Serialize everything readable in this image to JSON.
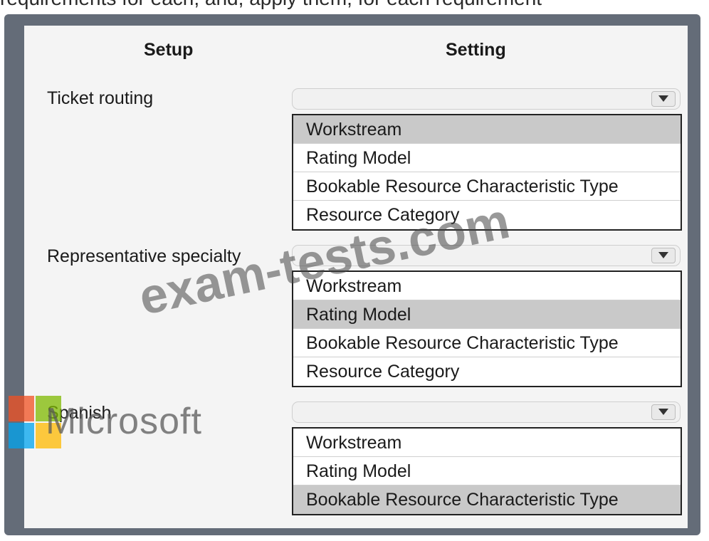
{
  "top_text": "requirements for each, and, apply them, for each requirement",
  "headers": {
    "setup": "Setup",
    "setting": "Setting"
  },
  "rows": [
    {
      "label": "Ticket routing",
      "selected_value": "",
      "options": [
        "Workstream",
        "Rating Model",
        "Bookable Resource Characteristic Type",
        "Resource Category"
      ],
      "highlighted": "Workstream"
    },
    {
      "label": "Representative specialty",
      "selected_value": "",
      "options": [
        "Workstream",
        "Rating Model",
        "Bookable Resource Characteristic Type",
        "Resource Category"
      ],
      "highlighted": "Rating Model"
    },
    {
      "label": "Spanish",
      "selected_value": "",
      "options": [
        "Workstream",
        "Rating Model",
        "Bookable Resource Characteristic Type"
      ],
      "highlighted": "Bookable Resource Characteristic Type"
    }
  ],
  "watermarks": {
    "exam": "exam-tests.com",
    "microsoft": "Microsoft"
  },
  "colors": {
    "frame": "#646c78",
    "panel": "#f4f4f4",
    "highlight": "#c9c9c9",
    "ms_red": "#f25022",
    "ms_green": "#7fba00",
    "ms_blue": "#00a4ef",
    "ms_yellow": "#ffb900"
  },
  "icons": {
    "dropdown": "chevron-down-icon"
  }
}
